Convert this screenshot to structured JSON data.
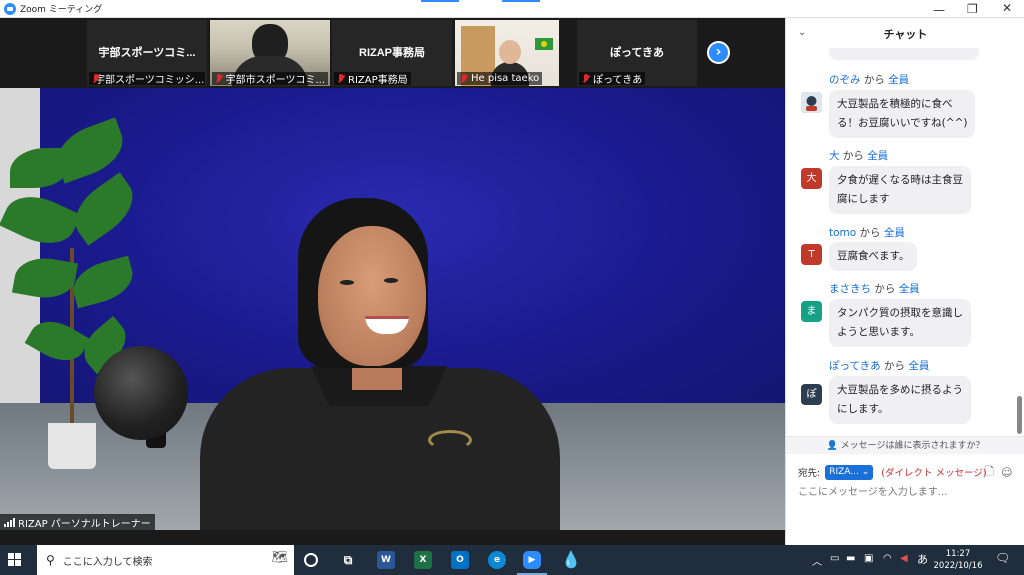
{
  "window": {
    "title": "Zoom ミーティング"
  },
  "thumbnails": [
    {
      "center_name": "宇部スポーツコミ...",
      "label": "宇部スポーツコミッシ...",
      "type": "name"
    },
    {
      "center_name": "",
      "label": "宇部市スポーツコミ...",
      "type": "camera"
    },
    {
      "center_name": "RIZAP事務局",
      "label": "RIZAP事務局",
      "type": "name"
    },
    {
      "center_name": "",
      "label": "He pisa taeko",
      "type": "camera"
    },
    {
      "center_name": "ぽってきあ",
      "label": "ぽってきあ",
      "type": "name"
    }
  ],
  "main_speaker": {
    "label": "RIZAP パーソナルトレーナー"
  },
  "chat": {
    "title": "チャット",
    "from_word": "から",
    "messages": [
      {
        "name": "のぞみ",
        "to": "全員",
        "avatar_text": "",
        "avatar_color": "#6a8fbf",
        "text": "大豆製品を積極的に食べ\nる！お豆腐いいですね(^^)"
      },
      {
        "name": "大",
        "to": "全員",
        "avatar_text": "大",
        "avatar_color": "#c0392b",
        "text": "夕食が遅くなる時は主食豆\n腐にします"
      },
      {
        "name": "tomo",
        "to": "全員",
        "avatar_text": "T",
        "avatar_color": "#c0392b",
        "text": "豆腐食べます。"
      },
      {
        "name": "まさきち",
        "to": "全員",
        "avatar_text": "ま",
        "avatar_color": "#16a085",
        "text": "タンパク質の摂取を意識し\nようと思います。"
      },
      {
        "name": "ぽってきあ",
        "to": "全員",
        "avatar_text": "ぽ",
        "avatar_color": "#2c3e50",
        "text": "大豆製品を多めに摂るよう\nにします。"
      }
    ],
    "who_sees": "メッセージは誰に表示されますか？",
    "recipient_label": "宛先:",
    "recipient_value": "RIZA...",
    "direct_message": "(ダイレクト メッセージ)",
    "input_placeholder": "ここにメッセージを入力します..."
  },
  "taskbar": {
    "search_placeholder": "ここに入力して検索",
    "time": "11:27",
    "date": "2022/10/16",
    "ime": "あ"
  }
}
